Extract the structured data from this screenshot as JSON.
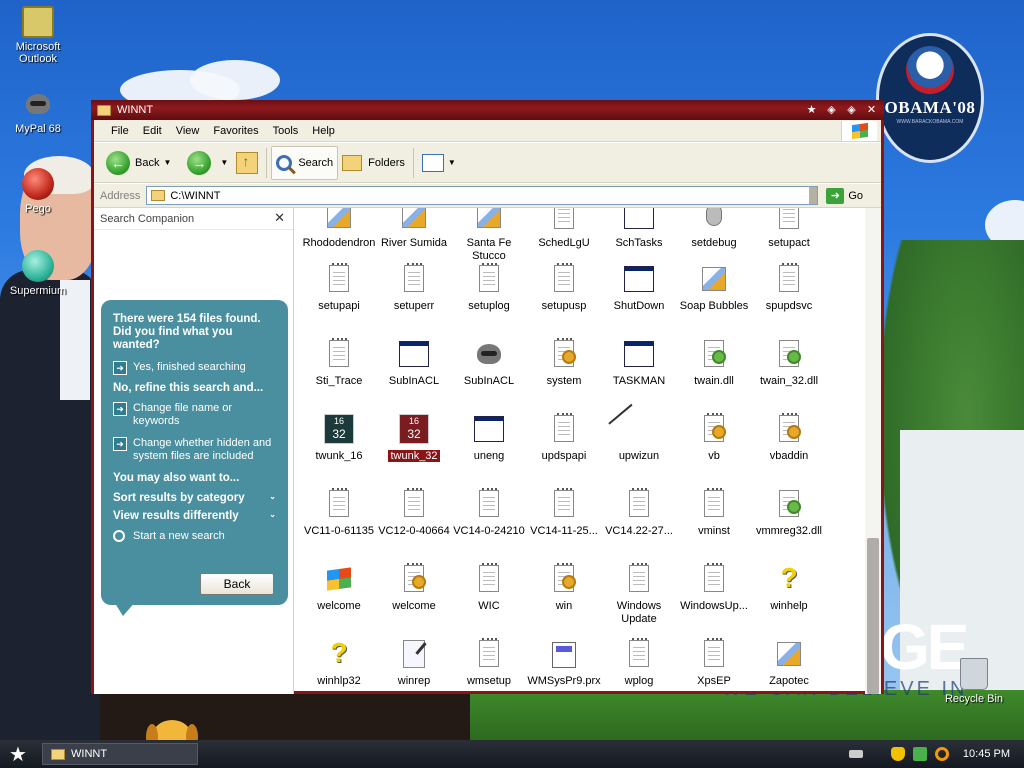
{
  "desktop": {
    "icons": [
      {
        "label": "Microsoft Outlook"
      },
      {
        "label": "MyPal 68"
      },
      {
        "label": "Pego"
      },
      {
        "label": "Supermium"
      }
    ],
    "recycle_bin": "Recycle Bin",
    "wallpaper": {
      "logo_text": "OBAMA'08",
      "logo_url": "WWW.BARACKOBAMA.COM",
      "big_text": "GE",
      "tagline": "WE CAN BELIEVE IN"
    }
  },
  "window": {
    "title": "WINNT",
    "title_buttons": [
      "★",
      "◈",
      "◈",
      "✕"
    ],
    "menu": [
      "File",
      "Edit",
      "View",
      "Favorites",
      "Tools",
      "Help"
    ],
    "toolbar": {
      "back": "Back",
      "search": "Search",
      "folders": "Folders"
    },
    "address": {
      "label": "Address",
      "value": "C:\\WINNT",
      "go": "Go"
    }
  },
  "search_companion": {
    "title": "Search Companion",
    "result_text": "There were 154 files found. Did you find what you wanted?",
    "yes": "Yes, finished searching",
    "refine_heading": "No, refine this search and...",
    "refine_options": [
      "Change file name or keywords",
      "Change whether hidden and system files are included"
    ],
    "also_heading": "You may also want to...",
    "sort": "Sort results by category",
    "view": "View results differently",
    "new_search": "Start a new search",
    "back_button": "Back"
  },
  "files": [
    {
      "name": "Rhododendron",
      "icon": "brush"
    },
    {
      "name": "River Sumida",
      "icon": "brush"
    },
    {
      "name": "Santa Fe Stucco",
      "icon": "brush"
    },
    {
      "name": "SchedLgU",
      "icon": "doc"
    },
    {
      "name": "SchTasks",
      "icon": "app"
    },
    {
      "name": "setdebug",
      "icon": "mouse"
    },
    {
      "name": "setupact",
      "icon": "doc"
    },
    {
      "name": "setupapi",
      "icon": "doc"
    },
    {
      "name": "setuperr",
      "icon": "doc"
    },
    {
      "name": "setuplog",
      "icon": "doc"
    },
    {
      "name": "setupusp",
      "icon": "doc"
    },
    {
      "name": "ShutDown",
      "icon": "app"
    },
    {
      "name": "Soap Bubbles",
      "icon": "brush"
    },
    {
      "name": "spupdsvc",
      "icon": "doc"
    },
    {
      "name": "Sti_Trace",
      "icon": "doc"
    },
    {
      "name": "SubInACL",
      "icon": "app"
    },
    {
      "name": "SubInACL",
      "icon": "raccoon"
    },
    {
      "name": "system",
      "icon": "doc-gear"
    },
    {
      "name": "TASKMAN",
      "icon": "app"
    },
    {
      "name": "twain.dll",
      "icon": "doc-gear-green"
    },
    {
      "name": "twain_32.dll",
      "icon": "doc-gear-green"
    },
    {
      "name": "twunk_16",
      "icon": "chip"
    },
    {
      "name": "twunk_32",
      "icon": "chip-red",
      "selected": true
    },
    {
      "name": "uneng",
      "icon": "app"
    },
    {
      "name": "updspapi",
      "icon": "doc"
    },
    {
      "name": "upwizun",
      "icon": "pick"
    },
    {
      "name": "vb",
      "icon": "doc-gear"
    },
    {
      "name": "vbaddin",
      "icon": "doc-gear"
    },
    {
      "name": "VC11-0-61135",
      "icon": "doc"
    },
    {
      "name": "VC12-0-40664",
      "icon": "doc"
    },
    {
      "name": "VC14-0-24210",
      "icon": "doc"
    },
    {
      "name": "VC14-11-25...",
      "icon": "doc"
    },
    {
      "name": "VC14.22-27...",
      "icon": "doc"
    },
    {
      "name": "vminst",
      "icon": "doc"
    },
    {
      "name": "vmmreg32.dll",
      "icon": "doc-gear-green"
    },
    {
      "name": "welcome",
      "icon": "winflag"
    },
    {
      "name": "welcome",
      "icon": "doc-gear"
    },
    {
      "name": "WIC",
      "icon": "doc"
    },
    {
      "name": "win",
      "icon": "doc-gear"
    },
    {
      "name": "Windows Update",
      "icon": "doc"
    },
    {
      "name": "WindowsUp...",
      "icon": "doc"
    },
    {
      "name": "winhelp",
      "icon": "qmark"
    },
    {
      "name": "winhlp32",
      "icon": "qmark"
    },
    {
      "name": "winrep",
      "icon": "notes"
    },
    {
      "name": "wmsetup",
      "icon": "doc"
    },
    {
      "name": "WMSysPr9.prx",
      "icon": "memo"
    },
    {
      "name": "wplog",
      "icon": "doc"
    },
    {
      "name": "XpsEP",
      "icon": "doc"
    },
    {
      "name": "Zapotec",
      "icon": "brush"
    }
  ],
  "chip_labels": {
    "top": "16",
    "bottom": "32"
  },
  "taskbar": {
    "task": "WINNT",
    "clock": "10:45 PM"
  },
  "colors": {
    "title_bar": "#8f1a1d",
    "selection": "#8a1517",
    "companion_bubble": "#4a8fa0",
    "desktop_sky": "#2c7ae0"
  }
}
